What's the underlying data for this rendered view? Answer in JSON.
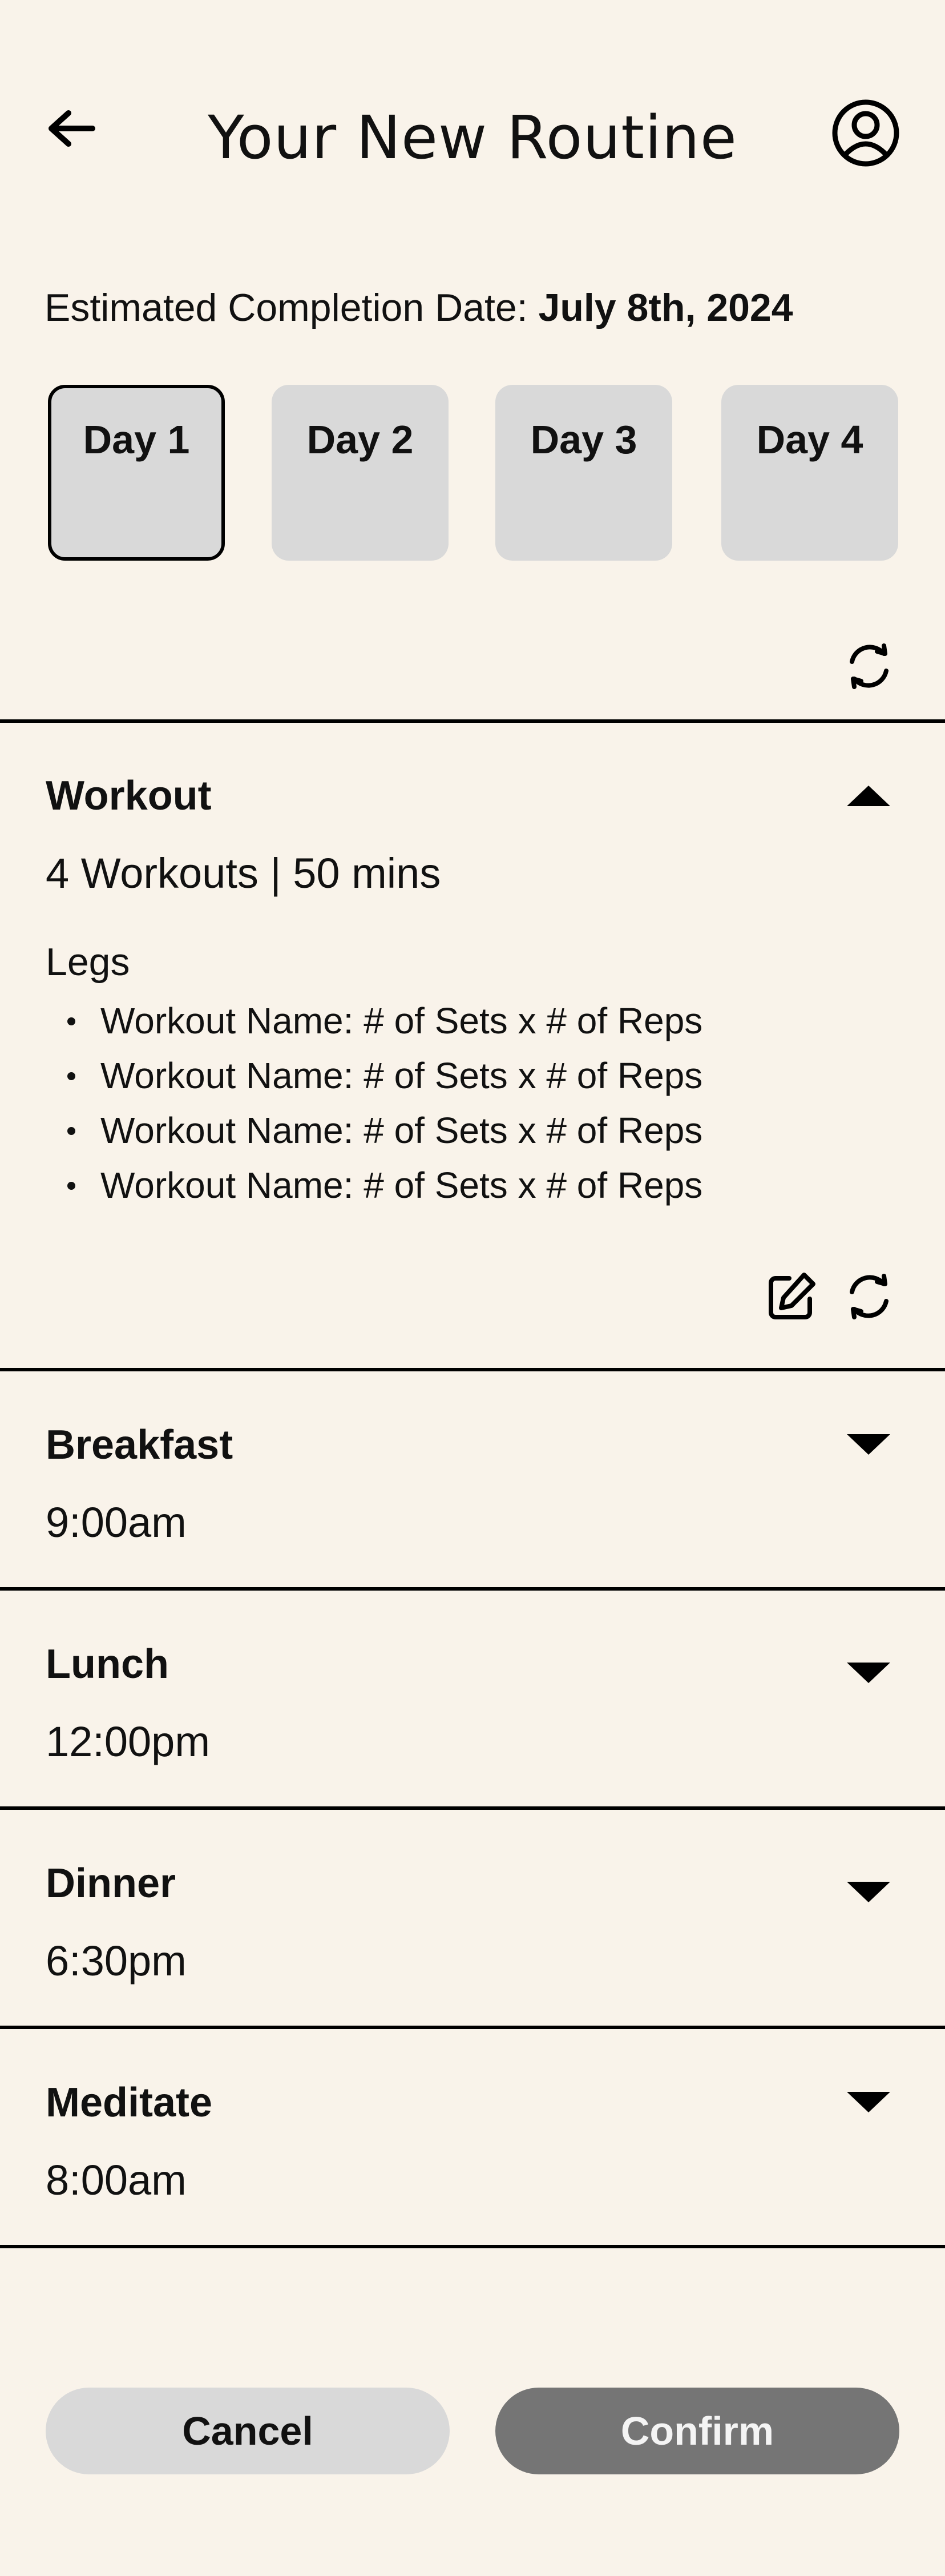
{
  "header": {
    "title": "Your New Routine",
    "back_icon": "arrow-left-icon",
    "profile_icon": "user-circle-icon"
  },
  "completion": {
    "label": "Estimated Completion Date:",
    "date": "July 8th, 2024"
  },
  "days": {
    "selected": "Day 1",
    "items": [
      {
        "label": "Day 1"
      },
      {
        "label": "Day 2"
      },
      {
        "label": "Day 3"
      },
      {
        "label": "Day 4"
      }
    ]
  },
  "workout": {
    "title": "Workout",
    "summary": "4 Workouts | 50 mins",
    "group": "Legs",
    "expanded": true,
    "items": [
      "Workout Name: # of Sets x # of Reps",
      "Workout Name: # of Sets x # of Reps",
      "Workout Name: # of Sets x # of Reps",
      "Workout Name: # of Sets x # of Reps"
    ]
  },
  "meals": {
    "breakfast": {
      "title": "Breakfast",
      "time": "9:00am"
    },
    "lunch": {
      "title": "Lunch",
      "time": "12:00pm"
    },
    "dinner": {
      "title": "Dinner",
      "time": "6:30pm"
    },
    "meditate": {
      "title": "Meditate",
      "time": "8:00am"
    }
  },
  "actions": {
    "cancel_label": "Cancel",
    "confirm_label": "Confirm"
  },
  "colors": {
    "background": "#f9f3ea",
    "tab_fill": "#d9d9d9",
    "confirm_fill": "#757575",
    "cancel_fill": "#d9d9d9"
  }
}
